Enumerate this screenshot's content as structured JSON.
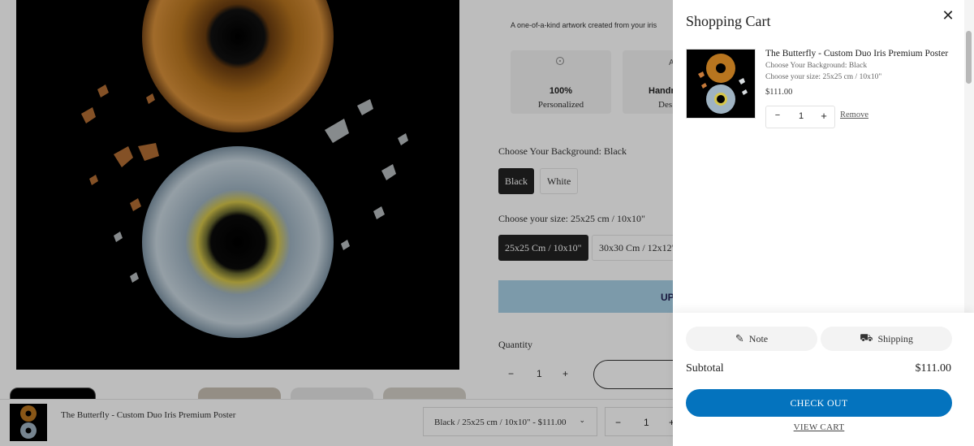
{
  "page": {
    "tagline": "A one-of-a-kind artwork created from your iris",
    "features": [
      {
        "title": "100%",
        "subtitle": "Personalized",
        "icon": "target-icon"
      },
      {
        "title": "Handm",
        "subtitle": "Des",
        "icon": "hand-icon",
        "icon_text": "A"
      }
    ],
    "background_label": "Choose Your Background: Black",
    "background_options": [
      "Black",
      "White"
    ],
    "size_label": "Choose your size: 25x25 cm / 10x10\"",
    "size_options": [
      "25x25 Cm / 10x10\"",
      "30x30 Cm / 12x12\""
    ],
    "upload_label": "UP",
    "quantity_label": "Quantity",
    "quantity": {
      "minus": "−",
      "value": "1",
      "plus": "+"
    }
  },
  "sticky_bar": {
    "title": "The Butterfly - Custom Duo Iris Premium Poster",
    "variant": "Black / 25x25 cm / 10x10\" - $111.00",
    "chevron": "⌄",
    "quantity": {
      "minus": "−",
      "value": "1",
      "plus": "+"
    }
  },
  "cart": {
    "title": "Shopping Cart",
    "close": "✕",
    "item": {
      "title": "The Butterfly - Custom Duo Iris Premium Poster",
      "option_background": "Choose Your Background: Black",
      "option_size": "Choose your size: 25x25 cm / 10x10\"",
      "price": "$111.00",
      "qty_minus": "−",
      "qty_value": "1",
      "qty_plus": "+",
      "remove": "Remove"
    },
    "note_label": "Note",
    "note_icon": "✎",
    "shipping_label": "Shipping",
    "shipping_icon": "⛟",
    "subtotal_label": "Subtotal",
    "subtotal_value": "$111.00",
    "checkout": "CHECK OUT",
    "view_cart": "VIEW CART"
  },
  "colors": {
    "checkout": "#0473be",
    "selected_option": "#222222",
    "upload_button": "#a8d0e6",
    "overlay": "rgba(0,0,0,0.26)"
  }
}
